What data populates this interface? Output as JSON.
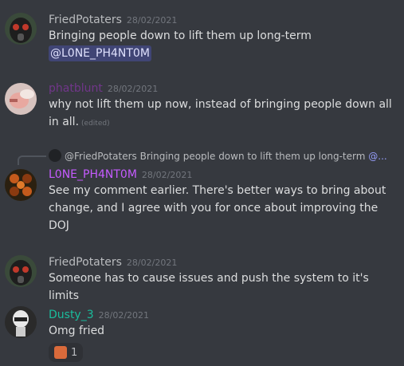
{
  "messages": [
    {
      "username": "FriedPotaters",
      "username_color": "#b9bbbe",
      "timestamp": "28/02/2021",
      "lines": [
        "Bringing people down to lift them up long-term"
      ],
      "mention": "@L0NE_PH4NT0M"
    },
    {
      "username": "phatblunt",
      "username_color": "#71368a",
      "timestamp": "28/02/2021",
      "lines": [
        "why not lift them up now, instead of bringing people down all",
        "in all."
      ],
      "edited": "(edited)"
    },
    {
      "reply": {
        "username": "@FriedPotaters",
        "text": "Bringing people down to lift them up long-term",
        "mention": "@..."
      },
      "username": "L0NE_PH4NT0M",
      "username_color": "#c55bff",
      "timestamp": "28/02/2021",
      "lines": [
        "See my comment earlier. There's better ways to bring about",
        "change, and I agree with you for once about improving the",
        "DOJ"
      ]
    },
    {
      "username": "FriedPotaters",
      "username_color": "#b9bbbe",
      "timestamp": "28/02/2021",
      "lines": [
        "Someone has to cause issues and push the system to it's limits"
      ]
    },
    {
      "username": "Dusty_3",
      "username_color": "#1abc9c",
      "timestamp": "28/02/2021",
      "lines": [
        "Omg fried"
      ],
      "reaction": {
        "emoji": "potato-face-emoji",
        "count": "1"
      }
    }
  ]
}
